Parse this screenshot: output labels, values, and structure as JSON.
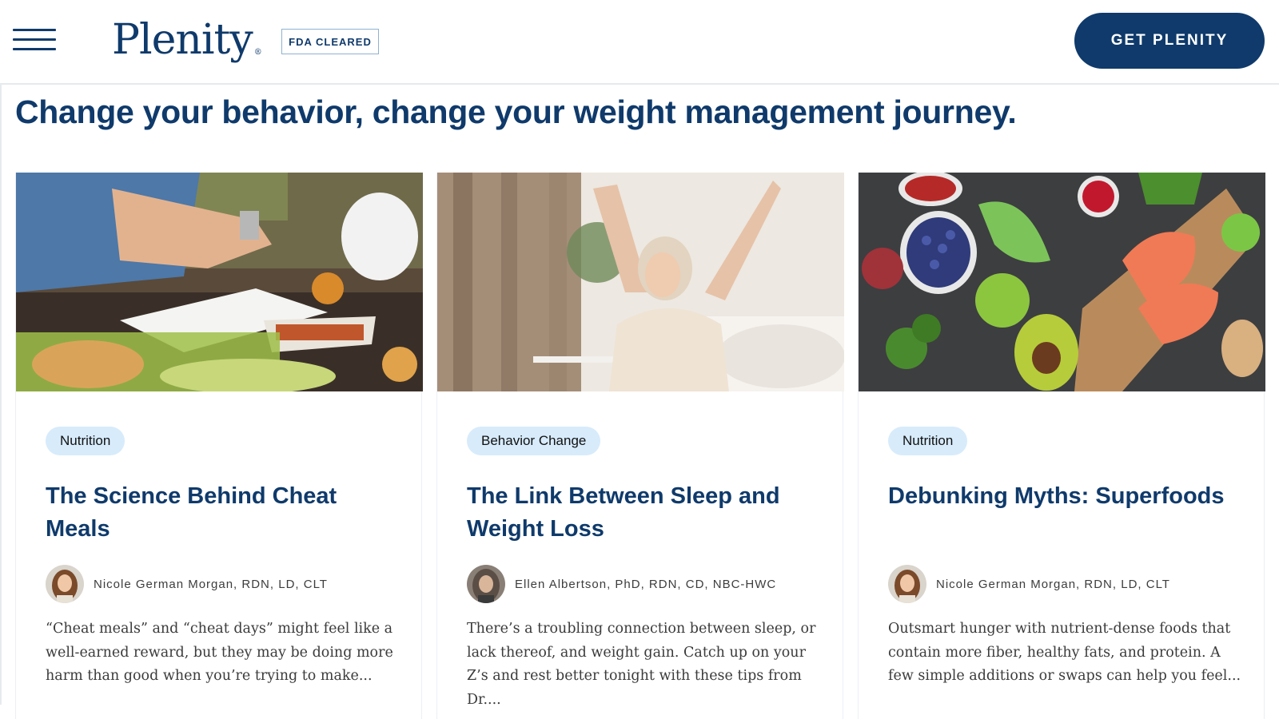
{
  "header": {
    "logo_text": "Plenity",
    "logo_mark": "®",
    "badge": "FDA CLEARED",
    "cta_label": "GET PLENITY",
    "menu_icon": "hamburger-menu-icon"
  },
  "colors": {
    "brand_navy": "#0f3a6b",
    "tag_bg": "#d7ebfb",
    "badge_border": "#8fb2d1"
  },
  "page": {
    "title": "Change your behavior, change your weight management journey."
  },
  "cards": [
    {
      "tag": "Nutrition",
      "title": "The Science Behind Cheat Meals",
      "author": "Nicole German Morgan, RDN, LD, CLT",
      "excerpt": "“Cheat meals” and “cheat days” might feel like a well-earned reward, but they may be doing more harm than good when you’re trying to make..."
    },
    {
      "tag": "Behavior Change",
      "title": "The Link Between Sleep and Weight Loss",
      "author": "Ellen Albertson, PhD, RDN, CD, NBC-HWC",
      "excerpt": "There’s a troubling connection between sleep, or lack thereof, and weight gain. Catch up on your Z’s and rest better tonight with these tips from Dr...."
    },
    {
      "tag": "Nutrition",
      "title": "Debunking Myths: Superfoods",
      "author": "Nicole German Morgan, RDN, LD, CLT",
      "excerpt": "Outsmart hunger with nutrient-dense foods that contain more fiber, healthy fats, and protein. A few simple additions or swaps can help you feel..."
    }
  ]
}
